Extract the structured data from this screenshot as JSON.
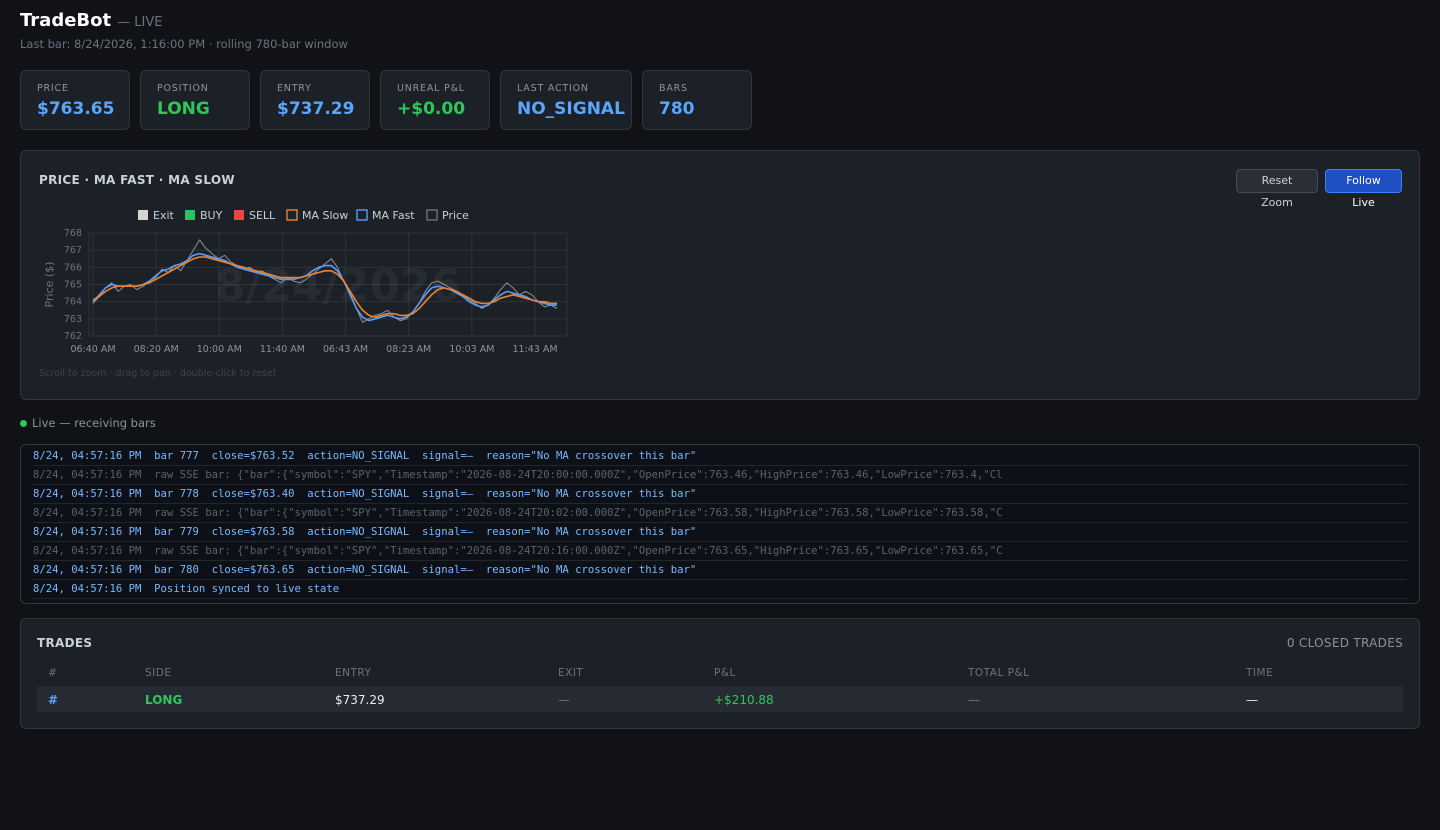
{
  "header": {
    "title": "TradeBot",
    "status": "— LIVE",
    "subtitle": "Last bar: 8/24/2026, 1:16:00 PM · rolling 780-bar window"
  },
  "cards": [
    {
      "label": "PRICE",
      "value": "$763.65",
      "color": "#58a6ff"
    },
    {
      "label": "POSITION",
      "value": "LONG",
      "color": "#2ec85a"
    },
    {
      "label": "ENTRY",
      "value": "$737.29",
      "color": "#58a6ff"
    },
    {
      "label": "UNREAL P&L",
      "value": "+$0.00",
      "color": "#2ec85a"
    },
    {
      "label": "LAST ACTION",
      "value": "NO_SIGNAL",
      "color": "#58a6ff"
    },
    {
      "label": "BARS",
      "value": "780",
      "color": "#58a6ff"
    }
  ],
  "chart": {
    "title": "PRICE · MA FAST · MA SLOW",
    "reset_label": "Reset Zoom",
    "follow_label": "Follow Live",
    "hint": "Scroll to zoom · drag to pan · double-click to reset",
    "watermark": "8/24/2026"
  },
  "chart_data": {
    "type": "line",
    "ylabel": "Price ($)",
    "ylim": [
      762,
      768
    ],
    "yticks": [
      768,
      767,
      766,
      765,
      764,
      763,
      762
    ],
    "xticks": [
      "06:40 AM",
      "08:20 AM",
      "10:00 AM",
      "11:40 AM",
      "06:43 AM",
      "08:23 AM",
      "10:03 AM",
      "11:43 AM"
    ],
    "legend": [
      {
        "name": "Exit",
        "color": "#d4d4d4",
        "filled": true
      },
      {
        "name": "BUY",
        "color": "#22c55e",
        "filled": true
      },
      {
        "name": "SELL",
        "color": "#ef4444",
        "filled": true
      },
      {
        "name": "MA Slow",
        "color": "#f0842c",
        "filled": false
      },
      {
        "name": "MA Fast",
        "color": "#5b9cf5",
        "filled": false
      },
      {
        "name": "Price",
        "color": "#6b7280",
        "filled": false
      }
    ],
    "series": [
      {
        "name": "Price",
        "color": "#8b929c",
        "values": [
          763.9,
          764.3,
          764.8,
          765.1,
          764.6,
          764.9,
          765.0,
          764.7,
          764.9,
          765.2,
          765.4,
          765.9,
          765.7,
          766.1,
          765.8,
          766.4,
          767.0,
          767.6,
          767.1,
          766.8,
          766.5,
          766.7,
          766.3,
          766.1,
          765.9,
          766.0,
          765.7,
          765.8,
          765.5,
          765.3,
          765.1,
          765.4,
          765.2,
          765.1,
          765.3,
          765.6,
          765.9,
          766.2,
          766.5,
          766.0,
          765.2,
          764.5,
          763.6,
          762.8,
          763.0,
          763.2,
          763.3,
          763.5,
          763.1,
          762.9,
          763.0,
          763.4,
          763.9,
          764.6,
          765.1,
          765.2,
          765.0,
          764.8,
          764.6,
          764.4,
          764.1,
          763.9,
          763.6,
          763.8,
          764.2,
          764.7,
          765.1,
          764.8,
          764.4,
          764.6,
          764.4,
          764.0,
          763.7,
          763.8,
          763.6
        ]
      },
      {
        "name": "MA Fast",
        "color": "#5b9cf5",
        "values": [
          764.0,
          764.4,
          764.8,
          765.0,
          764.9,
          764.9,
          764.9,
          764.9,
          765.0,
          765.2,
          765.5,
          765.8,
          765.9,
          766.1,
          766.2,
          766.4,
          766.7,
          766.8,
          766.7,
          766.6,
          766.5,
          766.4,
          766.2,
          766.0,
          765.9,
          765.8,
          765.7,
          765.6,
          765.5,
          765.4,
          765.3,
          765.3,
          765.3,
          765.4,
          765.5,
          765.8,
          766.0,
          766.1,
          766.1,
          765.8,
          765.2,
          764.4,
          763.6,
          763.1,
          762.9,
          763.0,
          763.1,
          763.2,
          763.1,
          763.0,
          763.1,
          763.4,
          763.9,
          764.4,
          764.8,
          764.9,
          764.8,
          764.7,
          764.5,
          764.3,
          764.0,
          763.8,
          763.7,
          763.8,
          764.1,
          764.4,
          764.6,
          764.5,
          764.4,
          764.3,
          764.1,
          764.0,
          763.9,
          763.8,
          763.8
        ]
      },
      {
        "name": "MA Slow",
        "color": "#f0842c",
        "values": [
          764.1,
          764.3,
          764.6,
          764.8,
          764.9,
          764.9,
          764.9,
          764.9,
          765.0,
          765.1,
          765.3,
          765.5,
          765.7,
          765.9,
          766.1,
          766.3,
          766.5,
          766.6,
          766.6,
          766.5,
          766.4,
          766.3,
          766.2,
          766.1,
          766.0,
          765.9,
          765.8,
          765.7,
          765.6,
          765.5,
          765.4,
          765.4,
          765.4,
          765.4,
          765.5,
          765.6,
          765.7,
          765.8,
          765.8,
          765.6,
          765.2,
          764.6,
          764.0,
          763.5,
          763.2,
          763.1,
          763.2,
          763.3,
          763.3,
          763.2,
          763.2,
          763.3,
          763.6,
          764.0,
          764.4,
          764.7,
          764.8,
          764.7,
          764.6,
          764.4,
          764.2,
          764.0,
          763.9,
          763.9,
          764.0,
          764.2,
          764.3,
          764.4,
          764.3,
          764.2,
          764.1,
          764.0,
          764.0,
          763.9,
          763.9
        ]
      }
    ]
  },
  "live": {
    "text": "Live — receiving bars"
  },
  "log": [
    {
      "text": "8/24, 04:57:16 PM  bar 777  close=$763.52  action=NO_SIGNAL  signal=—  reason=\"No MA crossover this bar\"",
      "type": "strong"
    },
    {
      "text": "8/24, 04:57:16 PM  raw SSE bar: {\"bar\":{\"symbol\":\"SPY\",\"Timestamp\":\"2026-08-24T20:00:00.000Z\",\"OpenPrice\":763.46,\"HighPrice\":763.46,\"LowPrice\":763.4,\"Cl",
      "type": "dim"
    },
    {
      "text": "8/24, 04:57:16 PM  bar 778  close=$763.40  action=NO_SIGNAL  signal=—  reason=\"No MA crossover this bar\"",
      "type": "strong"
    },
    {
      "text": "8/24, 04:57:16 PM  raw SSE bar: {\"bar\":{\"symbol\":\"SPY\",\"Timestamp\":\"2026-08-24T20:02:00.000Z\",\"OpenPrice\":763.58,\"HighPrice\":763.58,\"LowPrice\":763.58,\"C",
      "type": "dim"
    },
    {
      "text": "8/24, 04:57:16 PM  bar 779  close=$763.58  action=NO_SIGNAL  signal=—  reason=\"No MA crossover this bar\"",
      "type": "strong"
    },
    {
      "text": "8/24, 04:57:16 PM  raw SSE bar: {\"bar\":{\"symbol\":\"SPY\",\"Timestamp\":\"2026-08-24T20:16:00.000Z\",\"OpenPrice\":763.65,\"HighPrice\":763.65,\"LowPrice\":763.65,\"C",
      "type": "dim"
    },
    {
      "text": "8/24, 04:57:16 PM  bar 780  close=$763.65  action=NO_SIGNAL  signal=—  reason=\"No MA crossover this bar\"",
      "type": "strong"
    },
    {
      "text": "8/24, 04:57:16 PM  Position synced to live state",
      "type": "strong"
    }
  ],
  "trades": {
    "title": "TRADES",
    "count": "0 CLOSED TRADES",
    "columns": [
      "#",
      "SIDE",
      "ENTRY",
      "EXIT",
      "P&L",
      "TOTAL P&L",
      "TIME"
    ],
    "row": {
      "num": "#",
      "side": "LONG",
      "entry": "$737.29",
      "exit": "—",
      "pnl": "+$210.88",
      "total": "—",
      "time": "—"
    }
  }
}
